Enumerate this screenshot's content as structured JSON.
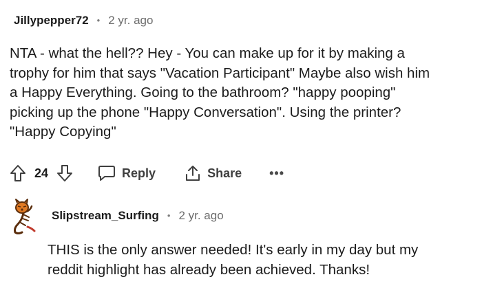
{
  "comment": {
    "author": "Jillypepper72",
    "separator": "•",
    "time": "2 yr. ago",
    "body_lines": [
      "NTA - what the hell?? Hey - You can make up for it by making a",
      "trophy for him that says \"Vacation Participant\" Maybe also wish him",
      "a Happy Everything. Going to the bathroom? \"happy pooping\"",
      "picking up the phone \"Happy Conversation\". Using the printer?",
      "\"Happy Copying\""
    ],
    "vote_count": "24",
    "reply_label": "Reply",
    "share_label": "Share",
    "more_label": "•••"
  },
  "reply_comment": {
    "author": "Slipstream_Surfing",
    "separator": "•",
    "time": "2 yr. ago",
    "body_lines": [
      "THIS is the only answer needed! It's early in my day but my",
      "reddit highlight has already been achieved. Thanks!"
    ]
  },
  "icons": {
    "upvote": "upvote-arrow-icon",
    "downvote": "downvote-arrow-icon",
    "reply": "speech-bubble-icon",
    "share": "share-upload-icon",
    "avatar": "tiger-cartoon-avatar"
  }
}
